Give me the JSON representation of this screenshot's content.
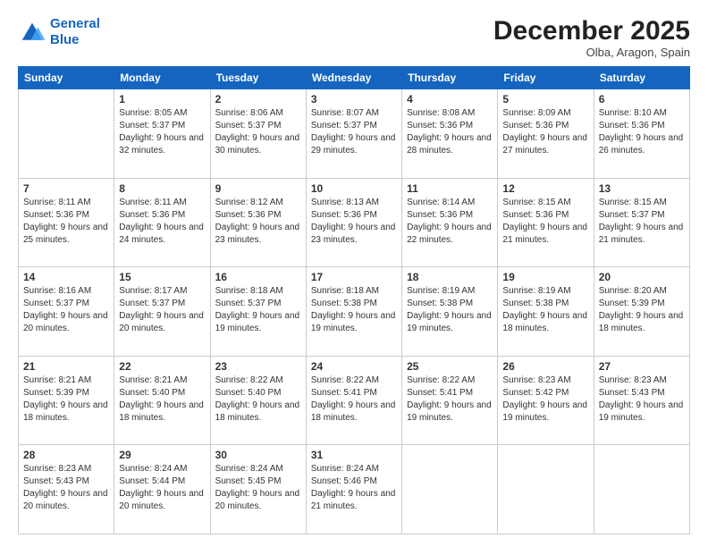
{
  "logo": {
    "line1": "General",
    "line2": "Blue"
  },
  "title": "December 2025",
  "location": "Olba, Aragon, Spain",
  "days_header": [
    "Sunday",
    "Monday",
    "Tuesday",
    "Wednesday",
    "Thursday",
    "Friday",
    "Saturday"
  ],
  "weeks": [
    [
      {
        "day": "",
        "sunrise": "",
        "sunset": "",
        "daylight": ""
      },
      {
        "day": "1",
        "sunrise": "Sunrise: 8:05 AM",
        "sunset": "Sunset: 5:37 PM",
        "daylight": "Daylight: 9 hours and 32 minutes."
      },
      {
        "day": "2",
        "sunrise": "Sunrise: 8:06 AM",
        "sunset": "Sunset: 5:37 PM",
        "daylight": "Daylight: 9 hours and 30 minutes."
      },
      {
        "day": "3",
        "sunrise": "Sunrise: 8:07 AM",
        "sunset": "Sunset: 5:37 PM",
        "daylight": "Daylight: 9 hours and 29 minutes."
      },
      {
        "day": "4",
        "sunrise": "Sunrise: 8:08 AM",
        "sunset": "Sunset: 5:36 PM",
        "daylight": "Daylight: 9 hours and 28 minutes."
      },
      {
        "day": "5",
        "sunrise": "Sunrise: 8:09 AM",
        "sunset": "Sunset: 5:36 PM",
        "daylight": "Daylight: 9 hours and 27 minutes."
      },
      {
        "day": "6",
        "sunrise": "Sunrise: 8:10 AM",
        "sunset": "Sunset: 5:36 PM",
        "daylight": "Daylight: 9 hours and 26 minutes."
      }
    ],
    [
      {
        "day": "7",
        "sunrise": "Sunrise: 8:11 AM",
        "sunset": "Sunset: 5:36 PM",
        "daylight": "Daylight: 9 hours and 25 minutes."
      },
      {
        "day": "8",
        "sunrise": "Sunrise: 8:11 AM",
        "sunset": "Sunset: 5:36 PM",
        "daylight": "Daylight: 9 hours and 24 minutes."
      },
      {
        "day": "9",
        "sunrise": "Sunrise: 8:12 AM",
        "sunset": "Sunset: 5:36 PM",
        "daylight": "Daylight: 9 hours and 23 minutes."
      },
      {
        "day": "10",
        "sunrise": "Sunrise: 8:13 AM",
        "sunset": "Sunset: 5:36 PM",
        "daylight": "Daylight: 9 hours and 23 minutes."
      },
      {
        "day": "11",
        "sunrise": "Sunrise: 8:14 AM",
        "sunset": "Sunset: 5:36 PM",
        "daylight": "Daylight: 9 hours and 22 minutes."
      },
      {
        "day": "12",
        "sunrise": "Sunrise: 8:15 AM",
        "sunset": "Sunset: 5:36 PM",
        "daylight": "Daylight: 9 hours and 21 minutes."
      },
      {
        "day": "13",
        "sunrise": "Sunrise: 8:15 AM",
        "sunset": "Sunset: 5:37 PM",
        "daylight": "Daylight: 9 hours and 21 minutes."
      }
    ],
    [
      {
        "day": "14",
        "sunrise": "Sunrise: 8:16 AM",
        "sunset": "Sunset: 5:37 PM",
        "daylight": "Daylight: 9 hours and 20 minutes."
      },
      {
        "day": "15",
        "sunrise": "Sunrise: 8:17 AM",
        "sunset": "Sunset: 5:37 PM",
        "daylight": "Daylight: 9 hours and 20 minutes."
      },
      {
        "day": "16",
        "sunrise": "Sunrise: 8:18 AM",
        "sunset": "Sunset: 5:37 PM",
        "daylight": "Daylight: 9 hours and 19 minutes."
      },
      {
        "day": "17",
        "sunrise": "Sunrise: 8:18 AM",
        "sunset": "Sunset: 5:38 PM",
        "daylight": "Daylight: 9 hours and 19 minutes."
      },
      {
        "day": "18",
        "sunrise": "Sunrise: 8:19 AM",
        "sunset": "Sunset: 5:38 PM",
        "daylight": "Daylight: 9 hours and 19 minutes."
      },
      {
        "day": "19",
        "sunrise": "Sunrise: 8:19 AM",
        "sunset": "Sunset: 5:38 PM",
        "daylight": "Daylight: 9 hours and 18 minutes."
      },
      {
        "day": "20",
        "sunrise": "Sunrise: 8:20 AM",
        "sunset": "Sunset: 5:39 PM",
        "daylight": "Daylight: 9 hours and 18 minutes."
      }
    ],
    [
      {
        "day": "21",
        "sunrise": "Sunrise: 8:21 AM",
        "sunset": "Sunset: 5:39 PM",
        "daylight": "Daylight: 9 hours and 18 minutes."
      },
      {
        "day": "22",
        "sunrise": "Sunrise: 8:21 AM",
        "sunset": "Sunset: 5:40 PM",
        "daylight": "Daylight: 9 hours and 18 minutes."
      },
      {
        "day": "23",
        "sunrise": "Sunrise: 8:22 AM",
        "sunset": "Sunset: 5:40 PM",
        "daylight": "Daylight: 9 hours and 18 minutes."
      },
      {
        "day": "24",
        "sunrise": "Sunrise: 8:22 AM",
        "sunset": "Sunset: 5:41 PM",
        "daylight": "Daylight: 9 hours and 18 minutes."
      },
      {
        "day": "25",
        "sunrise": "Sunrise: 8:22 AM",
        "sunset": "Sunset: 5:41 PM",
        "daylight": "Daylight: 9 hours and 19 minutes."
      },
      {
        "day": "26",
        "sunrise": "Sunrise: 8:23 AM",
        "sunset": "Sunset: 5:42 PM",
        "daylight": "Daylight: 9 hours and 19 minutes."
      },
      {
        "day": "27",
        "sunrise": "Sunrise: 8:23 AM",
        "sunset": "Sunset: 5:43 PM",
        "daylight": "Daylight: 9 hours and 19 minutes."
      }
    ],
    [
      {
        "day": "28",
        "sunrise": "Sunrise: 8:23 AM",
        "sunset": "Sunset: 5:43 PM",
        "daylight": "Daylight: 9 hours and 20 minutes."
      },
      {
        "day": "29",
        "sunrise": "Sunrise: 8:24 AM",
        "sunset": "Sunset: 5:44 PM",
        "daylight": "Daylight: 9 hours and 20 minutes."
      },
      {
        "day": "30",
        "sunrise": "Sunrise: 8:24 AM",
        "sunset": "Sunset: 5:45 PM",
        "daylight": "Daylight: 9 hours and 20 minutes."
      },
      {
        "day": "31",
        "sunrise": "Sunrise: 8:24 AM",
        "sunset": "Sunset: 5:46 PM",
        "daylight": "Daylight: 9 hours and 21 minutes."
      },
      {
        "day": "",
        "sunrise": "",
        "sunset": "",
        "daylight": ""
      },
      {
        "day": "",
        "sunrise": "",
        "sunset": "",
        "daylight": ""
      },
      {
        "day": "",
        "sunrise": "",
        "sunset": "",
        "daylight": ""
      }
    ]
  ]
}
